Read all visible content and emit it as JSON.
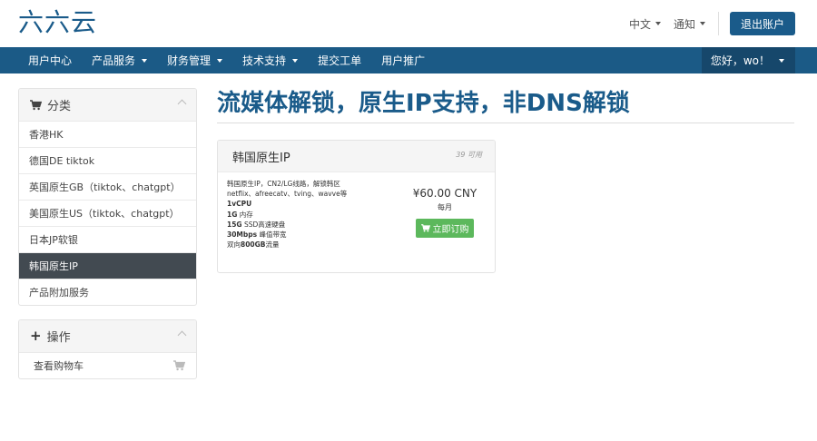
{
  "header": {
    "logo": "六六云",
    "language_label": "中文",
    "notifications_label": "通知",
    "logout_label": "退出账户"
  },
  "nav": {
    "items": [
      {
        "label": "用户中心"
      },
      {
        "label": "产品服务"
      },
      {
        "label": "财务管理"
      },
      {
        "label": "技术支持"
      },
      {
        "label": "提交工单"
      },
      {
        "label": "用户推广"
      }
    ],
    "user_label": "您好，wo！"
  },
  "sidebar": {
    "categories_title": "分类",
    "categories": [
      {
        "label": "香港HK"
      },
      {
        "label": "德国DE tiktok"
      },
      {
        "label": "英国原生GB（tiktok、chatgpt）"
      },
      {
        "label": "美国原生US（tiktok、chatgpt）"
      },
      {
        "label": "日本JP软银"
      },
      {
        "label": "韩国原生IP"
      },
      {
        "label": "产品附加服务"
      }
    ],
    "active_category": "韩国原生IP",
    "actions_title": "操作",
    "actions": [
      {
        "label": "查看购物车"
      }
    ]
  },
  "main": {
    "page_title": "流媒体解锁，原生IP支持，非DNS解锁",
    "product": {
      "name": "韩国原生IP",
      "stock": "39 可用",
      "description_lines": [
        "韩国原生IP，CN2/LG线路，解锁韩区",
        "netflix、afreecatv、tving、wavve等"
      ],
      "spec_cpu": "1vCPU",
      "spec_ram_value": "1G",
      "spec_ram_label": "内存",
      "spec_disk_value": "15G",
      "spec_disk_label": "SSD高速硬盘",
      "spec_bw_value": "30Mbps",
      "spec_bw_label": "峰值带宽",
      "spec_traffic_prefix": "双向",
      "spec_traffic_value": "800GB",
      "spec_traffic_suffix": "流量",
      "price": "¥60.00 CNY",
      "period": "每月",
      "order_label": "立即订购"
    }
  },
  "colors": {
    "brand": "#1a5b8a",
    "nav_bg": "#1b5a86",
    "active_item_bg": "#424a51",
    "order_button": "#5cb85c"
  }
}
